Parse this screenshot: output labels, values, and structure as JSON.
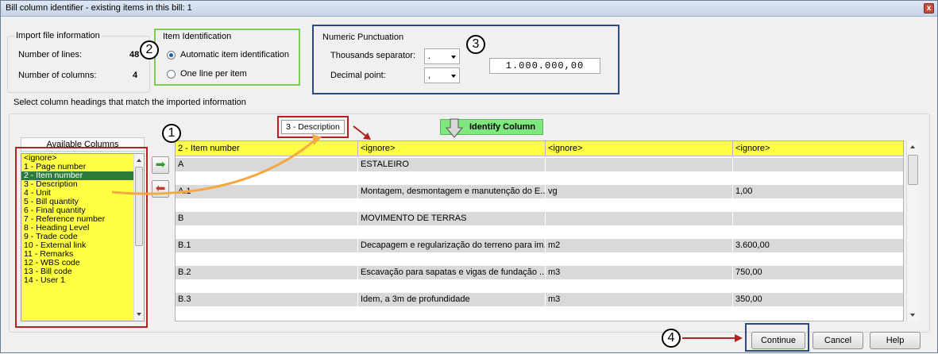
{
  "window": {
    "title": "Bill column identifier - existing items in this bill: 1",
    "close_glyph": "x"
  },
  "import_info": {
    "caption": "Import file information",
    "lines_label": "Number of lines:",
    "lines_value": "48",
    "columns_label": "Number of columns:",
    "columns_value": "4"
  },
  "item_identification": {
    "caption": "Item Identification",
    "options": [
      "Automatic item identification",
      "One line per item"
    ],
    "selected": 0
  },
  "numeric_punctuation": {
    "caption": "Numeric Punctuation",
    "thousands_label": "Thousands separator:",
    "thousands_value": ".",
    "decimal_label": "Decimal point:",
    "decimal_value": ",",
    "preview": "1.000.000,00"
  },
  "select_headings_label": "Select column headings that match the imported information",
  "available_columns": {
    "header": "Available Columns",
    "items": [
      "<ignore>",
      "1 - Page number",
      "2 - Item number",
      "3 - Description",
      "4 - Unit",
      "5 - Bill quantity",
      "6 - Final quantity",
      "7 - Reference number",
      "8 - Heading Level",
      "9 - Trade code",
      "10 - External link",
      "11 - Remarks",
      "12 - WBS code",
      "13 - Bill code",
      "14 - User 1"
    ],
    "selected": 2
  },
  "drag_tag": "3 - Description",
  "identify_button": "Identify Column",
  "grid": {
    "headers": [
      "2 - Item number",
      "<ignore>",
      "<ignore>",
      "<ignore>"
    ],
    "rows": [
      [
        "A",
        "ESTALEIRO",
        "",
        ""
      ],
      [
        "A.1",
        "Montagem, desmontagem e manutenção do E...",
        "vg",
        "1,00"
      ],
      [
        "B",
        "MOVIMENTO DE TERRAS",
        "",
        ""
      ],
      [
        "B.1",
        "Decapagem e regularização do terreno para im...",
        "m2",
        "3.600,00"
      ],
      [
        "B.2",
        "Escavação para sapatas e vigas de fundação ...",
        "m3",
        "750,00"
      ],
      [
        "B.3",
        "Idem, a 3m de profundidade",
        "m3",
        "350,00"
      ]
    ]
  },
  "callouts": [
    "1",
    "2",
    "3",
    "4"
  ],
  "buttons": {
    "continue": "Continue",
    "cancel": "Cancel",
    "help": "Help"
  },
  "colors": {
    "highlight": "#ffff44",
    "selected_row": "#2f7a3d",
    "identify": "#7ee77e",
    "annotation_red": "#b22222"
  }
}
